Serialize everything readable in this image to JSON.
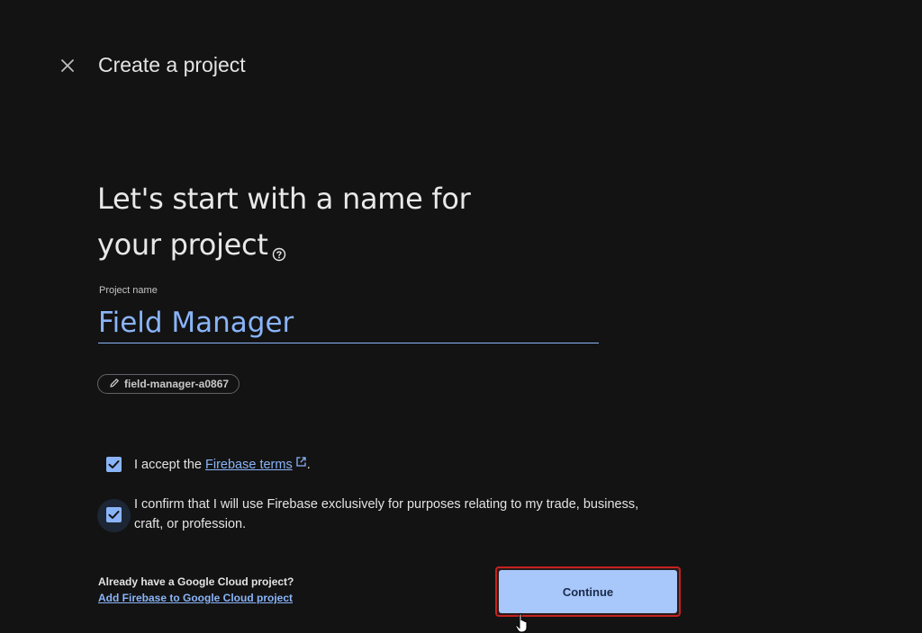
{
  "header": {
    "title": "Create a project"
  },
  "main": {
    "heading_line1": "Let's start with a name for",
    "heading_line2": "your project",
    "project_name_label": "Project name",
    "project_name_value": "Field Manager",
    "project_id": "field-manager-a0867"
  },
  "terms": {
    "accept_prefix": "I accept the ",
    "accept_link": "Firebase terms",
    "accept_suffix": ".",
    "accept_checked": true,
    "confirm_text": "I confirm that I will use Firebase exclusively for purposes relating to my trade, business, craft, or profession.",
    "confirm_checked": true
  },
  "footer": {
    "already_text": "Already have a Google Cloud project?",
    "add_link": "Add Firebase to Google Cloud project",
    "continue_label": "Continue"
  },
  "icons": {
    "close": "close-icon",
    "help": "help-circle-icon",
    "edit": "pencil-icon",
    "external": "external-link-icon",
    "check": "checkmark-icon",
    "cursor": "hand-pointer-icon"
  },
  "colors": {
    "background": "#131313",
    "accent": "#8ab4f8",
    "button": "#a8c7fa",
    "highlight_border": "#c5221f"
  }
}
